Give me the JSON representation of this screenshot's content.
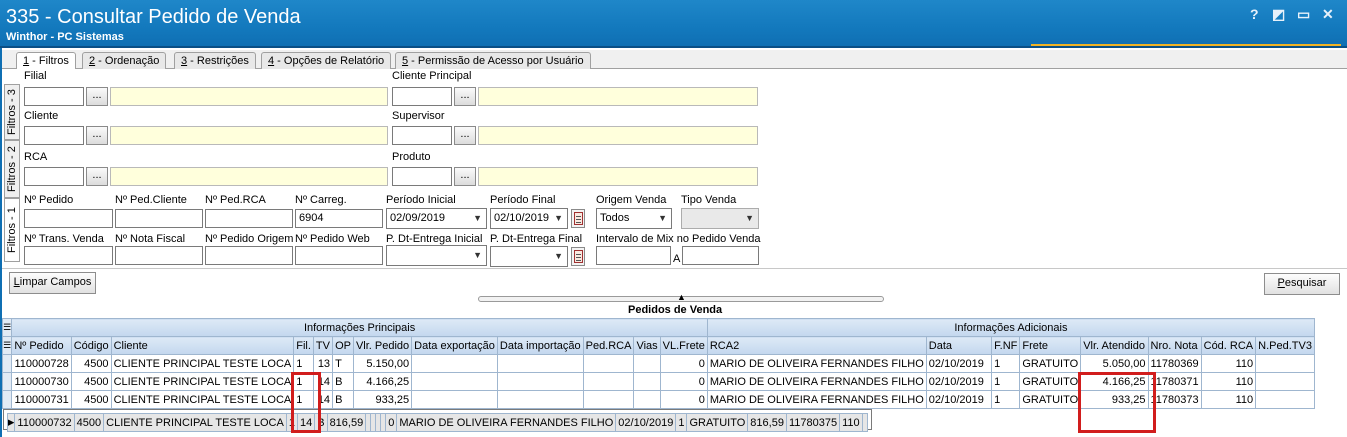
{
  "window": {
    "title": "335 - Consultar Pedido de Venda",
    "subtitle": "Winthor - PC Sistemas",
    "help_glyph": "?",
    "restore_glyph": "◩",
    "minimize_glyph": "▭",
    "close_glyph": "✕"
  },
  "tabs": [
    {
      "num": "1",
      "label": " - Filtros"
    },
    {
      "num": "2",
      "label": " - Ordenação"
    },
    {
      "num": "3",
      "label": " - Restrições"
    },
    {
      "num": "4",
      "label": " - Opções de Relatório"
    },
    {
      "num": "5",
      "label": " - Permissão de Acesso por Usuário"
    }
  ],
  "vertical_tabs": [
    "Filtros - 3",
    "Filtros - 2",
    "Filtros - 1"
  ],
  "filters": {
    "filial_label": "Filial",
    "cliente_principal_label": "Cliente Principal",
    "cliente_label": "Cliente",
    "supervisor_label": "Supervisor",
    "rca_label": "RCA",
    "produto_label": "Produto",
    "ellipsis": "...",
    "n_pedido_label": "Nº Pedido",
    "n_ped_cliente_label": "Nº Ped.Cliente",
    "n_ped_rca_label": "Nº Ped.RCA",
    "n_carreg_label": "Nº Carreg.",
    "n_carreg_value": "6904",
    "periodo_inicial_label": "Período Inicial",
    "periodo_inicial_value": "02/09/2019",
    "periodo_final_label": "Período Final",
    "periodo_final_value": "02/10/2019",
    "origem_venda_label": "Origem Venda",
    "origem_venda_value": "Todos",
    "tipo_venda_label": "Tipo Venda",
    "n_trans_venda_label": "Nº Trans. Venda",
    "n_nota_fiscal_label": "Nº Nota Fiscal",
    "n_pedido_origem_label": "Nº Pedido Origem",
    "n_pedido_web_label": "Nº Pedido Web",
    "p_dt_entrega_inicial_label": "P. Dt-Entrega Inicial",
    "p_dt_entrega_final_label": "P. Dt-Entrega Final",
    "intervalo_mix_label": "Intervalo de Mix no Pedido Venda",
    "intervalo_a": "A"
  },
  "buttons": {
    "limpar_first": "L",
    "limpar_rest": "impar Campos",
    "pesquisar_first": "P",
    "pesquisar_rest": "esquisar"
  },
  "grid": {
    "title": "Pedidos de  Venda",
    "group_headers": [
      "Informações Principais",
      "Informações Adicionais"
    ],
    "columns": [
      "Nº Pedido",
      "Código",
      "Cliente",
      "Fil.",
      "TV",
      "OP",
      "Vlr. Pedido",
      "Data exportação",
      "Data importação",
      "Ped.RCA",
      "Vias",
      "VL.Frete",
      "RCA2",
      "Data",
      "F.NF",
      "Frete",
      "Vlr. Atendido",
      "Nro. Nota",
      "Cód. RCA",
      "N.Ped.TV3"
    ],
    "rows": [
      [
        "110000728",
        "4500",
        "CLIENTE PRINCIPAL TESTE LOCA",
        "1",
        "13",
        "T",
        "5.150,00",
        "",
        "",
        "",
        "",
        "0",
        "MARIO DE OLIVEIRA FERNANDES FILHO",
        "02/10/2019",
        "1",
        "GRATUITO",
        "5.050,00",
        "11780369",
        "110",
        ""
      ],
      [
        "110000730",
        "4500",
        "CLIENTE PRINCIPAL TESTE LOCA",
        "1",
        "14",
        "B",
        "4.166,25",
        "",
        "",
        "",
        "",
        "0",
        "MARIO DE OLIVEIRA FERNANDES FILHO",
        "02/10/2019",
        "1",
        "GRATUITO",
        "4.166,25",
        "11780371",
        "110",
        ""
      ],
      [
        "110000731",
        "4500",
        "CLIENTE PRINCIPAL TESTE LOCA",
        "1",
        "14",
        "B",
        "933,25",
        "",
        "",
        "",
        "",
        "0",
        "MARIO DE OLIVEIRA FERNANDES FILHO",
        "02/10/2019",
        "1",
        "GRATUITO",
        "933,25",
        "11780373",
        "110",
        ""
      ],
      [
        "110000732",
        "4500",
        "CLIENTE PRINCIPAL TESTE LOCA",
        "1",
        "14",
        "B",
        "816,59",
        "",
        "",
        "",
        "",
        "0",
        "MARIO DE OLIVEIRA FERNANDES FILHO",
        "02/10/2019",
        "1",
        "GRATUITO",
        "816,59",
        "11780375",
        "110",
        ""
      ]
    ],
    "selected_row": 3
  },
  "colors": {
    "titlebar": "#1379bd",
    "highlight": "#d11d1d",
    "grid_header": "#c3d7ee"
  }
}
